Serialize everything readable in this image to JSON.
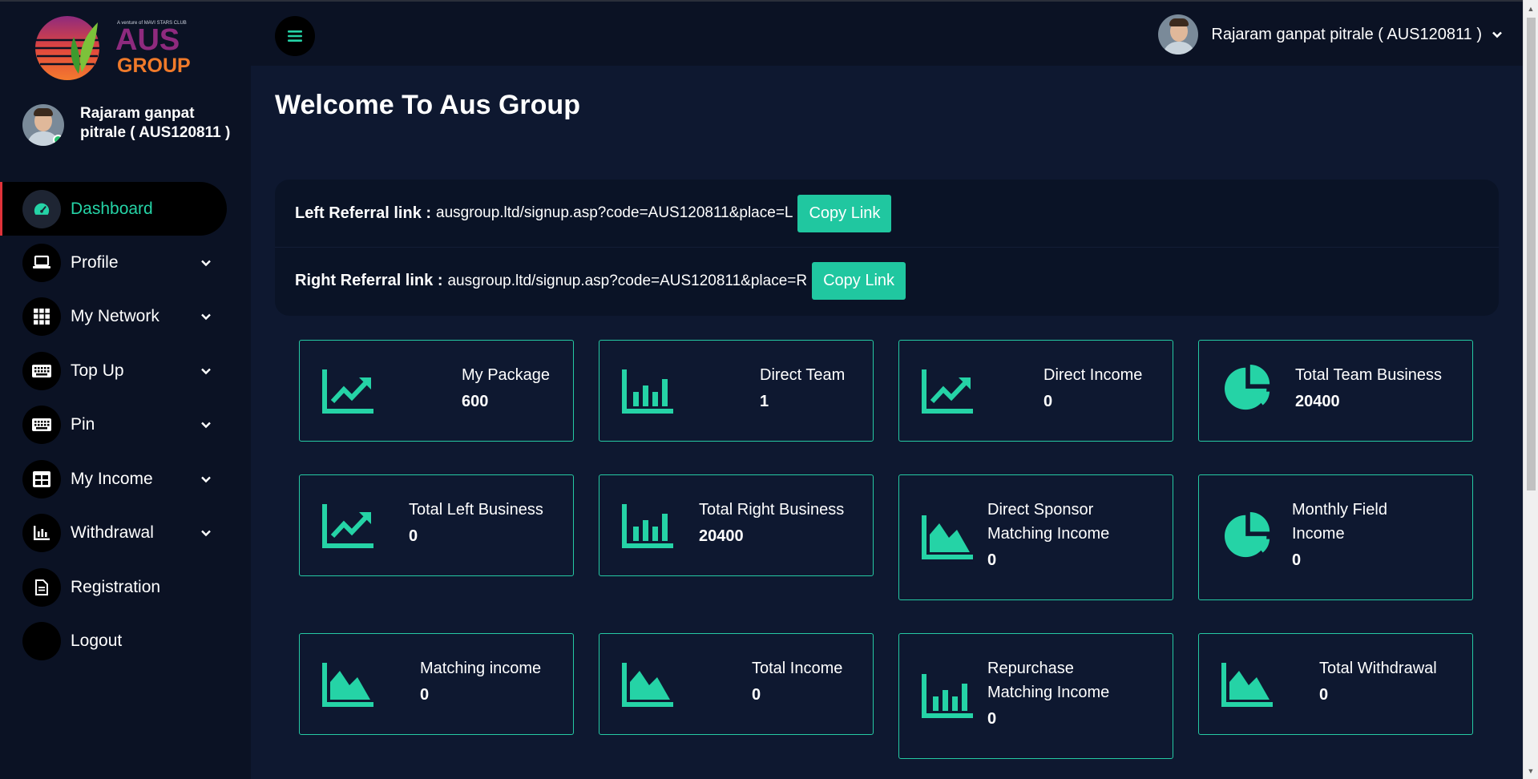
{
  "brand": {
    "logo_small_text": "A venture of MAVI STARS CLUB",
    "logo_text_line1": "AUS",
    "logo_text_line2": "GROUP"
  },
  "user": {
    "name": "Rajaram ganpat pitrale ( AUS120811 )"
  },
  "sidebar": {
    "items": [
      {
        "label": "Dashboard",
        "icon": "speedometer-icon",
        "active": true,
        "has_submenu": false
      },
      {
        "label": "Profile",
        "icon": "laptop-icon",
        "has_submenu": true
      },
      {
        "label": "My Network",
        "icon": "grid-icon",
        "has_submenu": true
      },
      {
        "label": "Top Up",
        "icon": "keyboard-icon",
        "has_submenu": true
      },
      {
        "label": "Pin",
        "icon": "keyboard-icon",
        "has_submenu": true
      },
      {
        "label": "My Income",
        "icon": "table-icon",
        "has_submenu": true
      },
      {
        "label": "Withdrawal",
        "icon": "bar-chart-icon",
        "has_submenu": true
      },
      {
        "label": "Registration",
        "icon": "document-icon",
        "has_submenu": false
      },
      {
        "label": "Logout",
        "icon": "",
        "has_submenu": false
      }
    ]
  },
  "main": {
    "title": "Welcome To Aus Group",
    "referral": {
      "left_label": "Left Referral link :",
      "left_url": "ausgroup.ltd/signup.asp?code=AUS120811&place=L",
      "right_label": "Right Referral link :",
      "right_url": "ausgroup.ltd/signup.asp?code=AUS120811&place=R",
      "copy_label": "Copy Link"
    },
    "stats": [
      {
        "title": "My Package",
        "value": "600",
        "icon": "line-chart-icon"
      },
      {
        "title": "Direct Team",
        "value": "1",
        "icon": "bar-chart-icon"
      },
      {
        "title": "Direct Income",
        "value": "0",
        "icon": "line-chart-icon"
      },
      {
        "title": "Total Team Business",
        "value": "20400",
        "icon": "pie-chart-icon"
      },
      {
        "title": "Total Left Business",
        "value": "0",
        "icon": "line-chart-icon"
      },
      {
        "title": "Total Right Business",
        "value": "20400",
        "icon": "bar-chart-icon"
      },
      {
        "title": "Direct Sponsor Matching Income",
        "title_line1": "Direct Sponsor",
        "title_line2": "Matching Income",
        "value": "0",
        "icon": "area-chart-icon"
      },
      {
        "title": "Monthly Field Income",
        "title_line1": "Monthly Field",
        "title_line2": "Income",
        "value": "0",
        "icon": "pie-chart-icon"
      },
      {
        "title": "Matching income",
        "value": "0",
        "icon": "area-chart-icon"
      },
      {
        "title": "Total Income",
        "value": "0",
        "icon": "area-chart-icon"
      },
      {
        "title": "Repurchase Matching Income",
        "title_line1": "Repurchase",
        "title_line2": "Matching Income",
        "value": "0",
        "icon": "bar-chart-icon"
      },
      {
        "title": "Total Withdrawal",
        "value": "0",
        "icon": "area-chart-icon"
      }
    ]
  },
  "colors": {
    "accent": "#25d3a6",
    "background": "#0b1224",
    "main_background": "#0e1830",
    "active_indicator": "#e0323a"
  }
}
